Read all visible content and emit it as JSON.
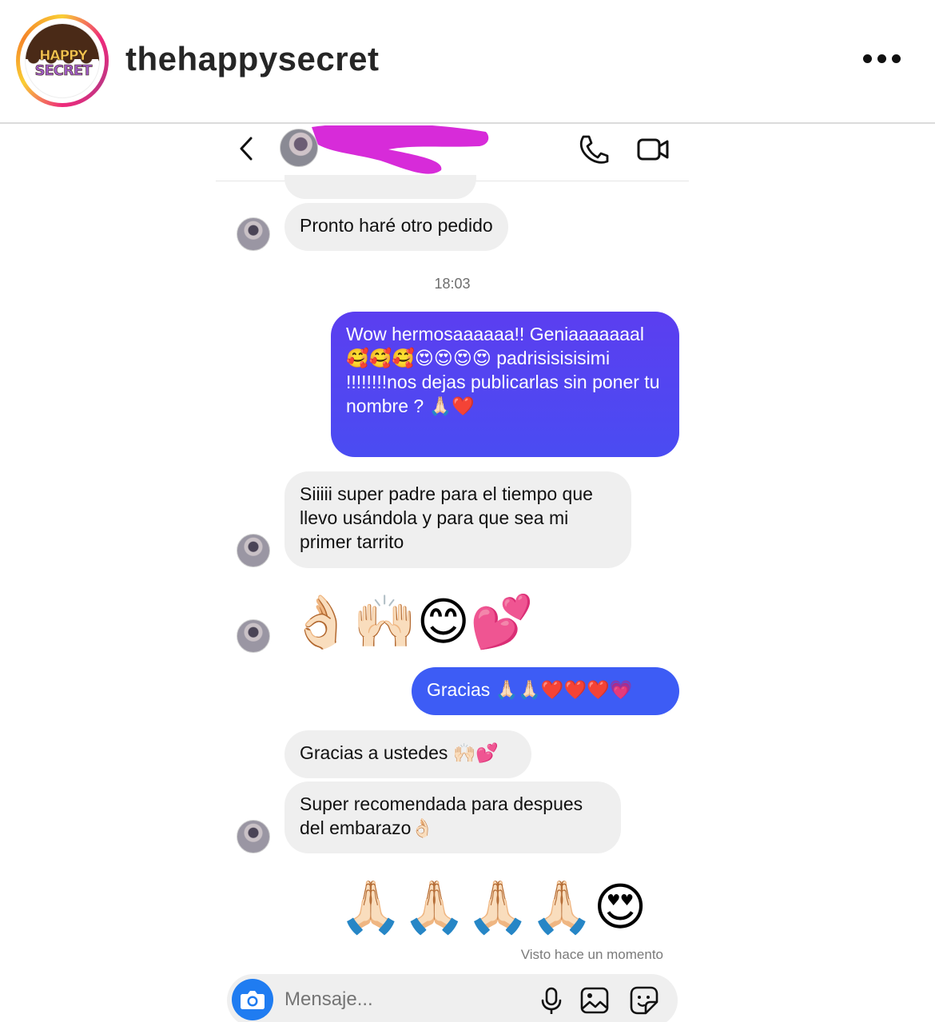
{
  "post": {
    "username": "thehappysecret",
    "logo": {
      "line1": "HAPPY",
      "line2": "SECRET"
    },
    "more_icon": "more-horizontal-icon"
  },
  "chat": {
    "icons": {
      "back": "chevron-left-icon",
      "call": "phone-icon",
      "video": "video-camera-icon"
    },
    "messages": [
      {
        "from": "them",
        "text": "Pronto haré otro pedido"
      },
      {
        "type": "timestamp",
        "text": "18:03"
      },
      {
        "from": "me",
        "text": "Wow hermosaaaaaa!!  Geniaaaaaaal 🥰🥰🥰😍😍😍😍 padrisisisisimi !!!!!!!!nos dejas publicarlas sin poner tu nombre ? 🙏🏻❤️"
      },
      {
        "from": "them",
        "text": "Siiiii super padre para el tiempo que llevo usándola y para que sea mi primer tarrito"
      },
      {
        "from": "them",
        "text": "👌🏻🙌🏻😊💕"
      },
      {
        "from": "me",
        "text": "Gracias 🙏🏻🙏🏻❤️❤️❤️💗"
      },
      {
        "from": "them",
        "text": "Gracias a ustedes 🙌🏻💕"
      },
      {
        "from": "them",
        "text": "Super recomendada para despues del embarazo👌🏻"
      },
      {
        "from": "me",
        "text": "🙏🏻🙏🏻🙏🏻🙏🏻😍"
      }
    ],
    "seen_text": "Visto hace un momento",
    "composer": {
      "placeholder": "Mensaje...",
      "icons": {
        "camera": "camera-icon",
        "mic": "microphone-icon",
        "gallery": "image-icon",
        "sticker": "sticker-icon"
      }
    }
  },
  "colors": {
    "outgoing_bubble": "#4f46f0",
    "incoming_bubble": "#efefef",
    "camera_button": "#1f7cf1",
    "redaction": "#d72bd9"
  }
}
